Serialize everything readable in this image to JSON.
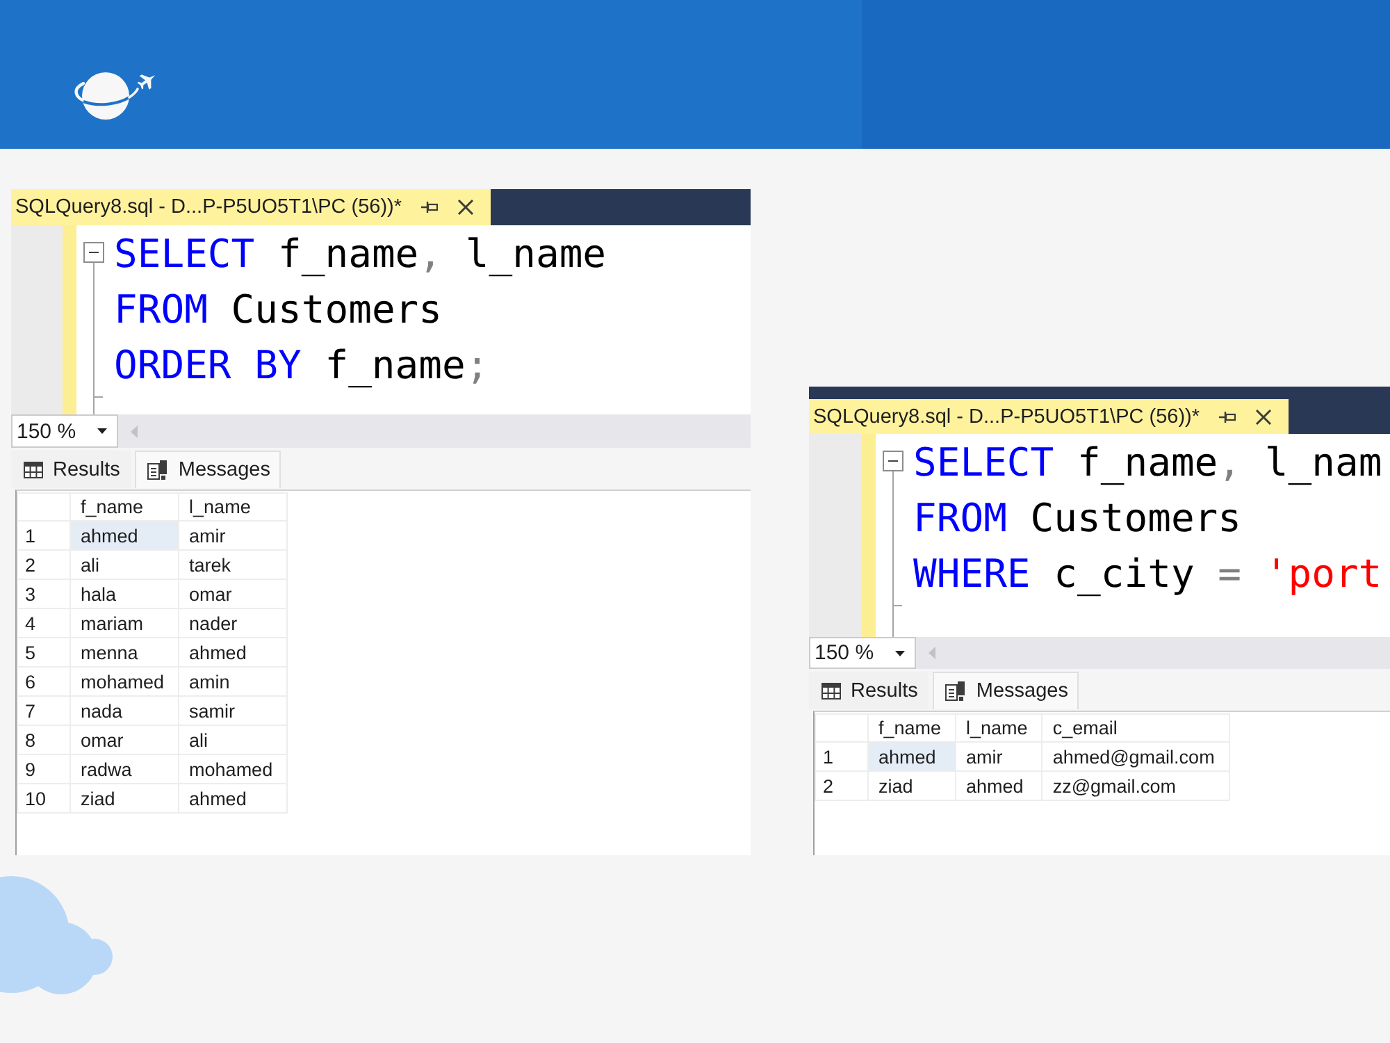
{
  "windows": [
    {
      "tab": {
        "title": "SQLQuery8.sql - D...P-P5UO5T1\\PC (56))*",
        "selected": true
      },
      "editor": {
        "expanded": true,
        "lines": [
          [
            {
              "text": "SELECT",
              "kind": "keyword"
            },
            {
              "text": " f_name",
              "kind": "plain"
            },
            {
              "text": ",",
              "kind": "punct"
            },
            {
              "text": " l_name",
              "kind": "plain"
            }
          ],
          [
            {
              "text": "FROM",
              "kind": "keyword"
            },
            {
              "text": " Customers",
              "kind": "plain"
            }
          ],
          [
            {
              "text": "ORDER BY",
              "kind": "keyword"
            },
            {
              "text": " f_name",
              "kind": "plain"
            },
            {
              "text": ";",
              "kind": "punct"
            }
          ]
        ]
      },
      "zoom": "150 %",
      "result_tabs": [
        {
          "label": "Results",
          "kind": "grid",
          "selected": true
        },
        {
          "label": "Messages",
          "kind": "messages",
          "selected": false
        }
      ],
      "grid": {
        "columns": [
          "f_name",
          "l_name"
        ],
        "rows": [
          {
            "number": "1",
            "cells": [
              {
                "text": "ahmed",
                "selected": true
              },
              {
                "text": "amir",
                "selected": false
              }
            ]
          },
          {
            "number": "2",
            "cells": [
              {
                "text": "ali",
                "selected": false
              },
              {
                "text": "tarek",
                "selected": false
              }
            ]
          },
          {
            "number": "3",
            "cells": [
              {
                "text": "hala",
                "selected": false
              },
              {
                "text": "omar",
                "selected": false
              }
            ]
          },
          {
            "number": "4",
            "cells": [
              {
                "text": "mariam",
                "selected": false
              },
              {
                "text": "nader",
                "selected": false
              }
            ]
          },
          {
            "number": "5",
            "cells": [
              {
                "text": "menna",
                "selected": false
              },
              {
                "text": "ahmed",
                "selected": false
              }
            ]
          },
          {
            "number": "6",
            "cells": [
              {
                "text": "mohamed",
                "selected": false
              },
              {
                "text": "amin",
                "selected": false
              }
            ]
          },
          {
            "number": "7",
            "cells": [
              {
                "text": "nada",
                "selected": false
              },
              {
                "text": "samir",
                "selected": false
              }
            ]
          },
          {
            "number": "8",
            "cells": [
              {
                "text": "omar",
                "selected": false
              },
              {
                "text": "ali",
                "selected": false
              }
            ]
          },
          {
            "number": "9",
            "cells": [
              {
                "text": "radwa",
                "selected": false
              },
              {
                "text": "mohamed",
                "selected": false
              }
            ]
          },
          {
            "number": "10",
            "cells": [
              {
                "text": "ziad",
                "selected": false
              },
              {
                "text": "ahmed",
                "selected": false
              }
            ]
          }
        ]
      }
    },
    {
      "tab": {
        "title": "SQLQuery8.sql - D...P-P5UO5T1\\PC (56))*",
        "selected": true
      },
      "editor": {
        "expanded": true,
        "lines": [
          [
            {
              "text": "SELECT",
              "kind": "keyword"
            },
            {
              "text": " f_name",
              "kind": "plain"
            },
            {
              "text": ",",
              "kind": "punct"
            },
            {
              "text": " l_nam",
              "kind": "plain"
            }
          ],
          [
            {
              "text": "FROM",
              "kind": "keyword"
            },
            {
              "text": " Customers",
              "kind": "plain"
            }
          ],
          [
            {
              "text": "WHERE",
              "kind": "keyword"
            },
            {
              "text": " c_city ",
              "kind": "plain"
            },
            {
              "text": "=",
              "kind": "punct"
            },
            {
              "text": " 'port",
              "kind": "string"
            }
          ]
        ]
      },
      "zoom": "150 %",
      "result_tabs": [
        {
          "label": "Results",
          "kind": "grid",
          "selected": true
        },
        {
          "label": "Messages",
          "kind": "messages",
          "selected": false
        }
      ],
      "grid": {
        "columns": [
          "f_name",
          "l_name",
          "c_email"
        ],
        "rows": [
          {
            "number": "1",
            "cells": [
              {
                "text": "ahmed",
                "selected": true
              },
              {
                "text": "amir",
                "selected": false
              },
              {
                "text": "ahmed@gmail.com",
                "selected": false
              }
            ]
          },
          {
            "number": "2",
            "cells": [
              {
                "text": "ziad",
                "selected": false
              },
              {
                "text": "ahmed",
                "selected": false
              },
              {
                "text": "zz@gmail.com",
                "selected": false
              }
            ]
          }
        ]
      }
    }
  ]
}
